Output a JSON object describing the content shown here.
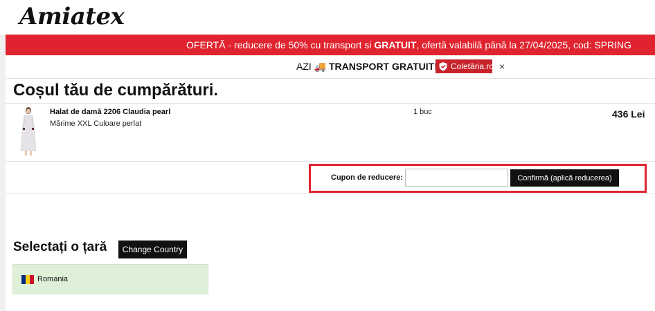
{
  "brand": {
    "logo_text": "Amiatex"
  },
  "promo": {
    "prefix": "OFERTĂ - reducere de 50% cu transport si ",
    "highlight": "GRATUIT",
    "suffix": ", ofertă valabilă până la 27/04/2025, cod: SPRING",
    "bg_color": "#e0242f"
  },
  "shipping": {
    "prefix": "AZI ",
    "truck_icon": "🚚",
    "bold_text": "TRANSPORT GRATUIT!",
    "partner_name": "Coletăria.ro",
    "partner_icon": "shield-icon",
    "close_glyph": "×"
  },
  "cart": {
    "title": "Coșul tău de cumpărături.",
    "items": [
      {
        "name": "Halat de damă 2206 Claudia pearl",
        "meta": "Mărime XXL Culoare perlat",
        "quantity": "1 buc",
        "price": "436 Lei"
      }
    ]
  },
  "coupon": {
    "label": "Cupon de reducere:",
    "input_value": "",
    "input_placeholder": "",
    "button_label": "Confirmă (aplică reducerea)",
    "highlight_color": "#e0242f"
  },
  "country": {
    "heading": "Selectați o țară",
    "change_button": "Change Country",
    "selected": "Romania",
    "flag_colors": [
      "#002b7f",
      "#fcd116",
      "#ce1126"
    ]
  }
}
